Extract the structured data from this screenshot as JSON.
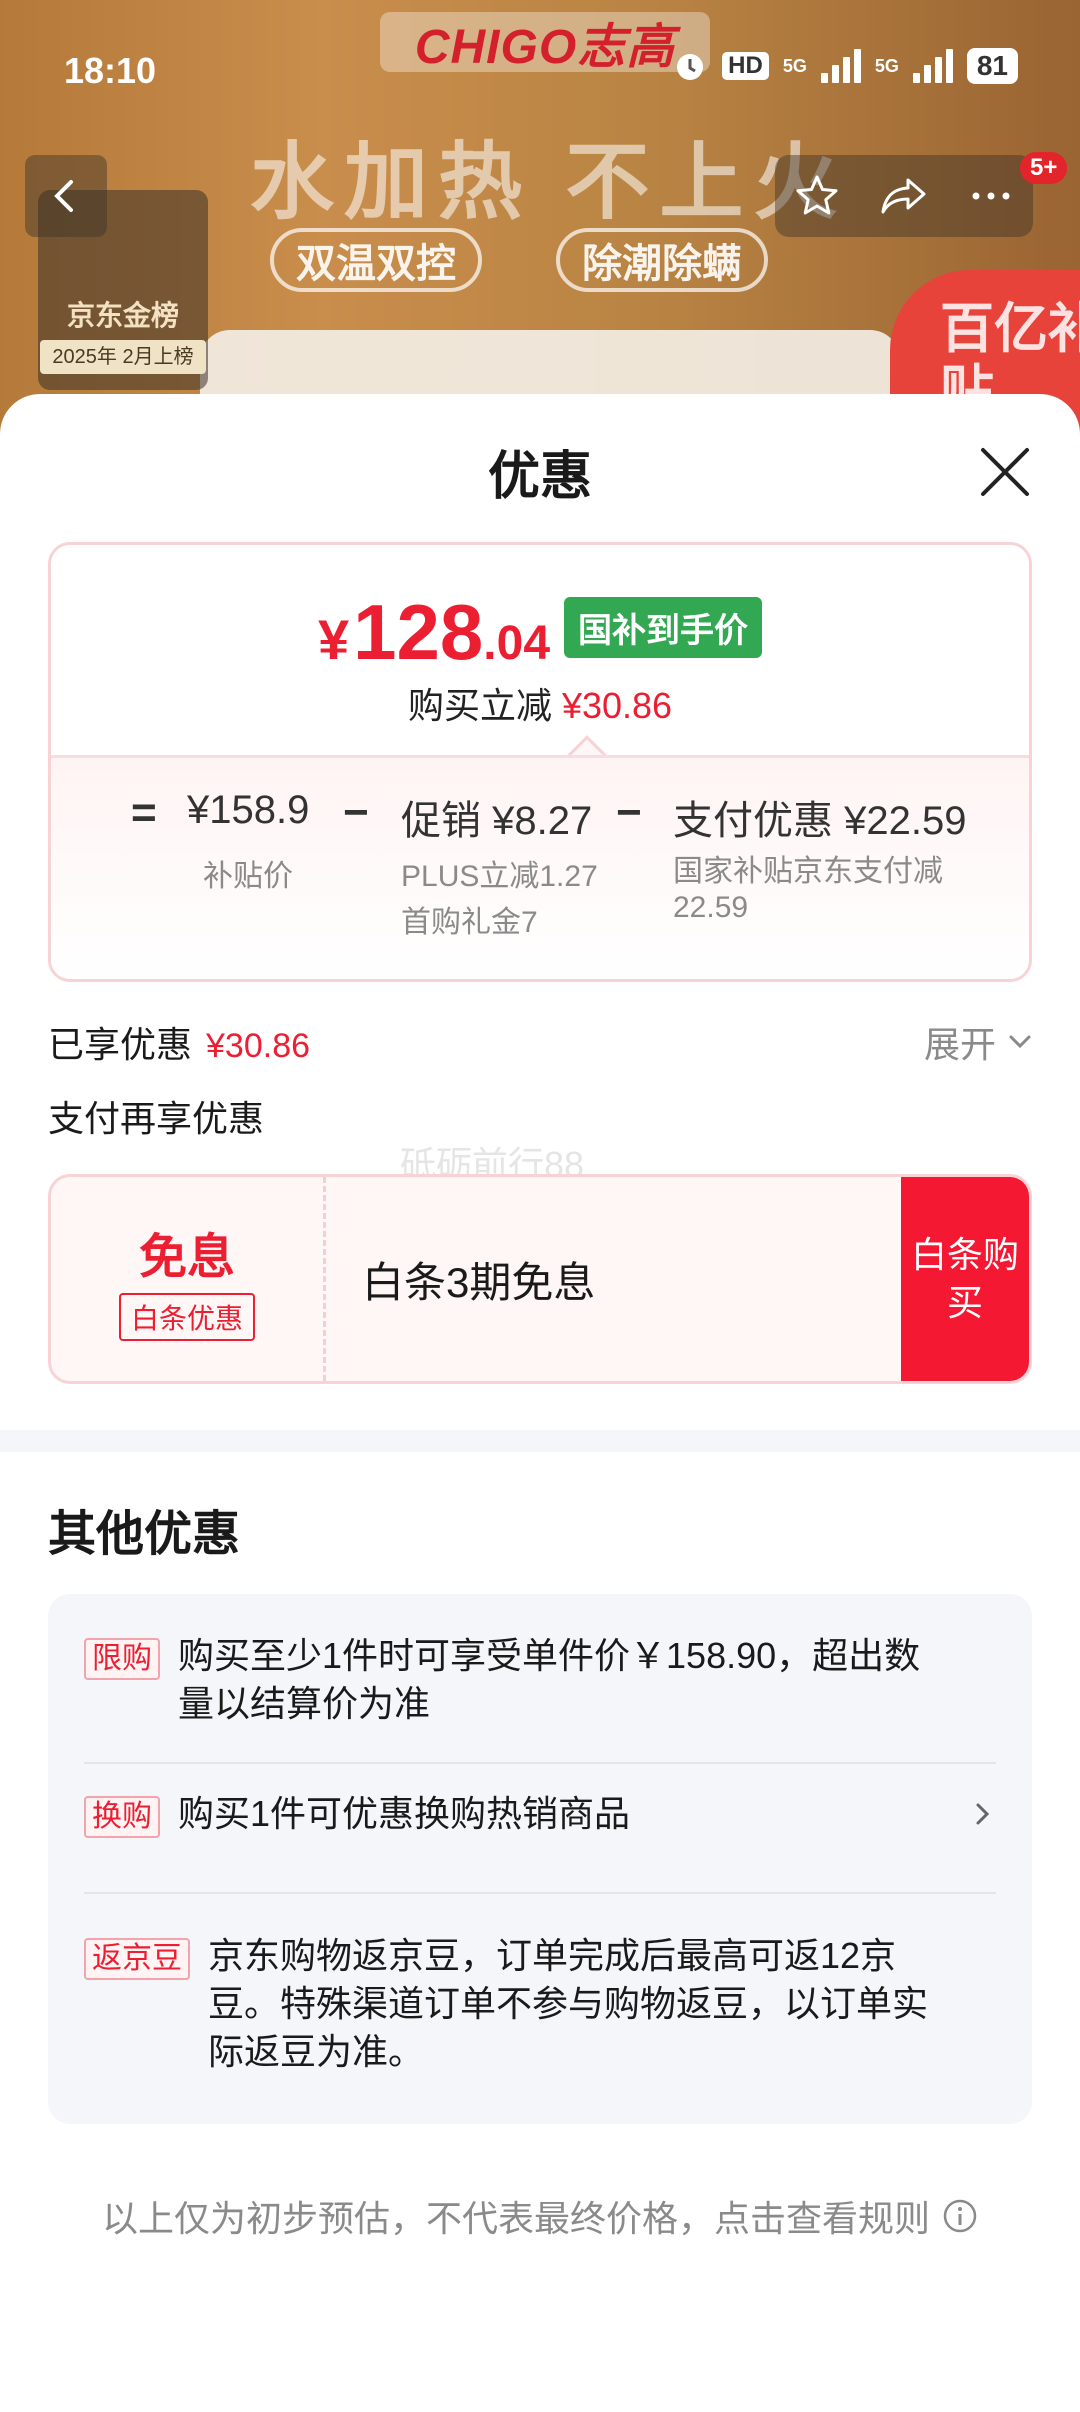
{
  "status_bar": {
    "time": "18:10",
    "hd": "HD",
    "net1": "5G",
    "net2": "5G",
    "battery": "81"
  },
  "banner": {
    "brand": "CHIGO志高",
    "slogan": "水加热 不上火",
    "pill1": "双温双控",
    "pill2": "除潮除螨",
    "jd_gold_title": "京东金榜",
    "jd_gold_sub": "2025年 2月上榜",
    "subsidy": "百亿补贴",
    "badge": "5+"
  },
  "sheet": {
    "title": "优惠",
    "price": {
      "currency": "¥",
      "integer": "128",
      "decimal": ".04",
      "tag": "国补到手价",
      "reduce_label": "购买立减",
      "reduce_amount": "¥30.86"
    },
    "formula": {
      "eq": "=",
      "base_amount": "¥158.9",
      "base_label": "补贴价",
      "minus1": "−",
      "promo_label": "促销",
      "promo_amount": "¥8.27",
      "promo_detail1": "PLUS立减1.27",
      "promo_detail2": "首购礼金7",
      "minus2": "−",
      "pay_label": "支付优惠",
      "pay_amount": "¥22.59",
      "pay_detail": "国家补贴京东支付减22.59"
    },
    "enjoyed_label": "已享优惠",
    "enjoyed_amount": "¥30.86",
    "expand_label": "展开",
    "pay_again_label": "支付再享优惠",
    "watermark": "砥砺前行88",
    "baitiao": {
      "big": "免息",
      "tag": "白条优惠",
      "desc": "白条3期免息",
      "button": "白条购买"
    },
    "other": {
      "title": "其他优惠",
      "offers": [
        {
          "tag": "限购",
          "text": "购买至少1件时可享受单件价￥158.90，超出数量以结算价为准"
        },
        {
          "tag": "换购",
          "text": "购买1件可优惠换购热销商品"
        },
        {
          "tag": "返京豆",
          "text": "京东购物返京豆，订单完成后最高可返12京豆。特殊渠道订单不参与购物返豆，以订单实际返豆为准。"
        }
      ]
    },
    "footnote": "以上仅为初步预估，不代表最终价格，点击查看规则"
  }
}
